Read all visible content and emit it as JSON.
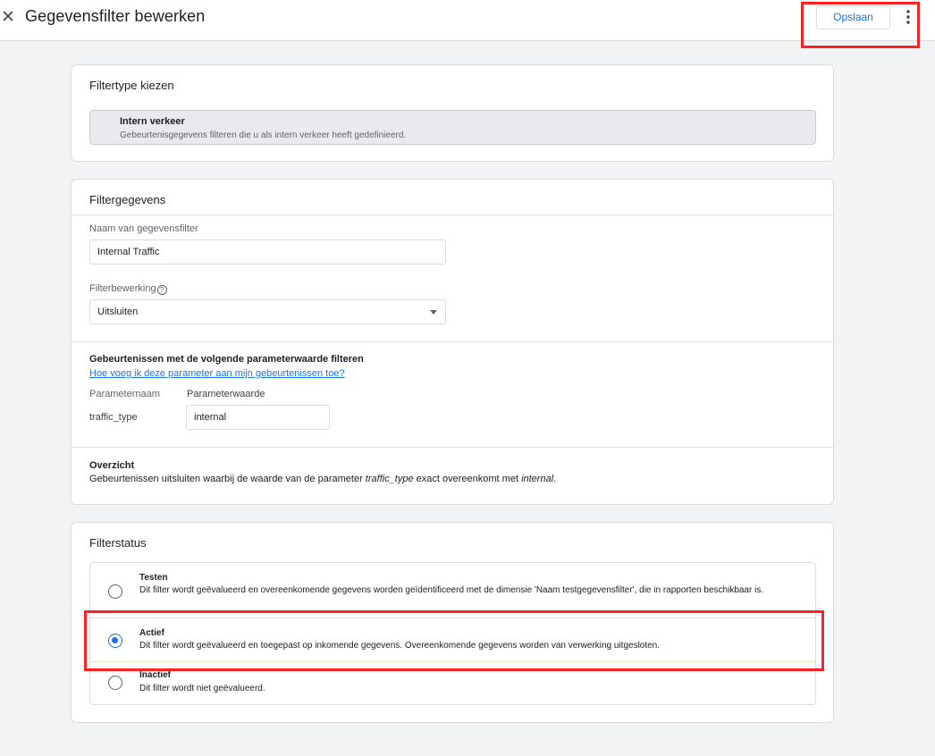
{
  "header": {
    "title": "Gegevensfilter bewerken",
    "save_label": "Opslaan",
    "close_icon": "close-icon",
    "more_icon": "more-vert-icon"
  },
  "filter_type": {
    "heading": "Filtertype kiezen",
    "option_title": "Intern verkeer",
    "option_description": "Gebeurtenisgegevens filteren die u als intern verkeer heeft gedefinieerd."
  },
  "filter_details": {
    "heading": "Filtergegevens",
    "name_label": "Naam van gegevensfilter",
    "name_value": "Internal Traffic",
    "operation_label": "Filterbewerking",
    "operation_help_icon": "?",
    "operation_value": "Uitsluiten",
    "param_section_title": "Gebeurtenissen met de volgende parameterwaarde filteren",
    "param_help_link": "Hoe voeg ik deze parameter aan mijn gebeurtenissen toe?",
    "param_name_header": "Parameternaam",
    "param_value_header": "Parameterwaarde",
    "param_name": "traffic_type",
    "param_value": "internal",
    "summary_title": "Overzicht",
    "summary_prefix": "Gebeurtenissen uitsluiten waarbij de waarde van de parameter ",
    "summary_param": "traffic_type",
    "summary_middle": " exact overeenkomt met ",
    "summary_value": "internal",
    "summary_suffix": "."
  },
  "filter_status": {
    "heading": "Filterstatus",
    "selected": "Actief",
    "options": [
      {
        "name": "Testen",
        "description": "Dit filter wordt geëvalueerd en overeenkomende gegevens worden geïdentificeerd met de dimensie 'Naam testgegevensfilter', die in rapporten beschikbaar is."
      },
      {
        "name": "Actief",
        "description": "Dit filter wordt geëvalueerd en toegepast op inkomende gegevens. Overeenkomende gegevens worden van verwerking uitgesloten."
      },
      {
        "name": "Inactief",
        "description": "Dit filter wordt niet geëvalueerd."
      }
    ]
  },
  "colors": {
    "accent": "#1a73e8",
    "highlight": "#ff2020",
    "background": "#f1f3f4"
  }
}
